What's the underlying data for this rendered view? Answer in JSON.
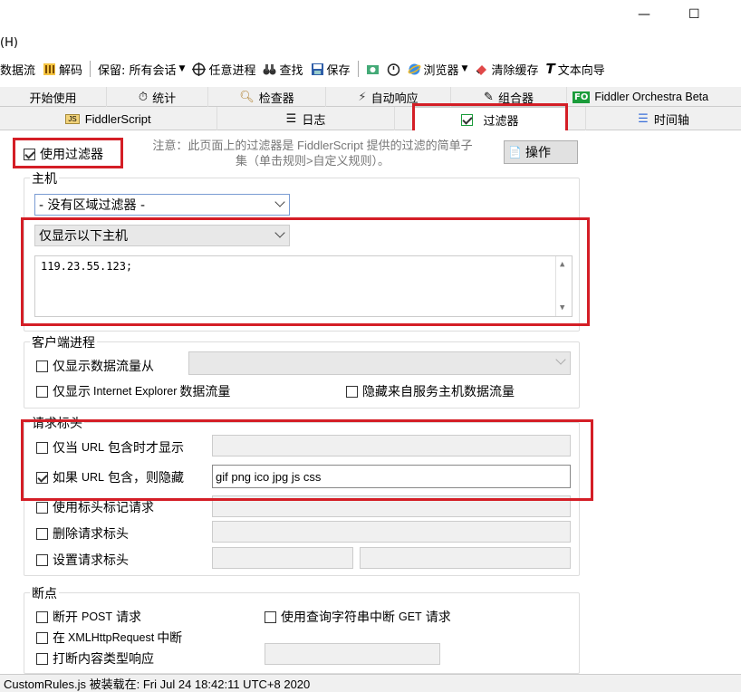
{
  "window": {
    "minimize": "—",
    "maximize": "☐"
  },
  "menu": {
    "help": "(H)"
  },
  "toolbar": {
    "items": [
      "数据流",
      "解码",
      "保留: 所有会话",
      "任意进程",
      "查找",
      "保存",
      "浏览器",
      "清除缓存",
      "文本向导"
    ]
  },
  "tabs_row1": [
    "开始使用",
    "统计",
    "检查器",
    "自动响应",
    "组合器",
    "Fiddler Orchestra Beta"
  ],
  "tabs_row2": [
    "FiddlerScript",
    "日志",
    "过滤器",
    "时间轴"
  ],
  "filters": {
    "use_filters_label": "使用过滤器",
    "use_filters_checked": true,
    "notice": "注意：此页面上的过滤器是 FiddlerScript 提供的过滤的简单子集（单击规则>自定义规则）。",
    "notice_line1": "注意：此页面上的过滤器是 FiddlerScript 提供的过滤的简单子",
    "notice_line2": "集（单击规则>自定义规则）。",
    "actions_button": "操作",
    "hosts": {
      "group_label": "主机",
      "zone_select": "- 没有区域过滤器 -",
      "host_mode_select": "仅显示以下主机",
      "host_list": "119.23.55.123;"
    },
    "client_process": {
      "group_label": "客户端进程",
      "show_only_from": "仅显示数据流量从",
      "show_only_ie_prefix": "仅显示",
      "show_only_ie_mid": "Internet Explorer",
      "show_only_ie_suffix": "数据流量",
      "hide_service_host": "隐藏来自服务主机数据流量"
    },
    "request_headers": {
      "group_label": "请求标头",
      "show_if_url_contains_prefix": "仅当",
      "show_if_url_contains_mid": "URL",
      "show_if_url_contains_suffix": "包含时才显示",
      "show_if_url_contains_checked": false,
      "hide_if_url_contains_prefix": "如果",
      "hide_if_url_contains_mid": "URL",
      "hide_if_url_contains_suffix": "包含，则隐藏",
      "hide_if_url_contains_checked": true,
      "hide_url_value": "gif png ico jpg js css",
      "flag_requests": "使用标头标记请求",
      "delete_request_header": "删除请求标头",
      "set_request_header": "设置请求标头"
    },
    "breakpoints": {
      "group_label": "断点",
      "break_post_prefix": "断开",
      "break_post_mid": "POST",
      "break_post_suffix": "请求",
      "break_get_query_prefix": "使用查询字符串中断",
      "break_get_query_mid": "GET",
      "break_get_query_suffix": "请求",
      "break_xhr_prefix": "在",
      "break_xhr_mid": "XMLHttpRequest",
      "break_xhr_suffix": "中断",
      "break_content_type": "打断内容类型响应"
    }
  },
  "status": {
    "text": "CustomRules.js 被装载在: Fri Jul 24 18:42:11 UTC+8 2020"
  },
  "colors": {
    "highlight_red": "#d41e26",
    "accent_blue": "#7a9cd3"
  }
}
